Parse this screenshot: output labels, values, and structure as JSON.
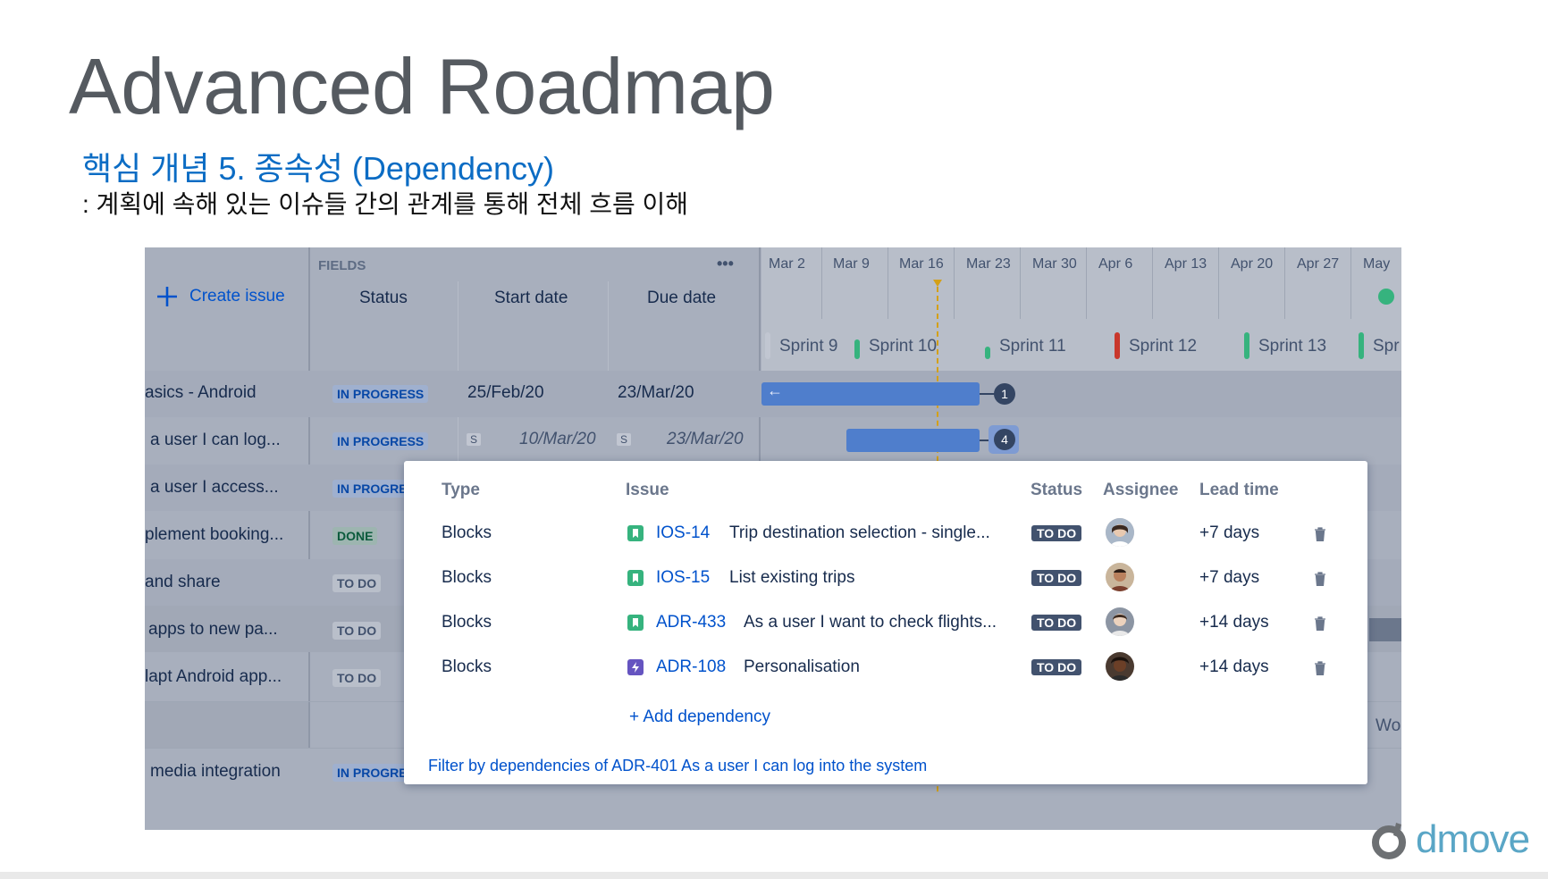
{
  "slide": {
    "title": "Advanced Roadmap",
    "subtitle": "핵심 개념 5. 종속성 (Dependency)",
    "description": ": 계획에 속해 있는 이슈들 간의 관계를 통해 전체 흐름 이해",
    "logo_text": "dmove"
  },
  "roadmap": {
    "create_issue_label": "Create issue",
    "fields_label": "FIELDS",
    "more_label": "•••",
    "columns": [
      "Status",
      "Start date",
      "Due date"
    ],
    "timeline_dates": [
      "Mar 2",
      "Mar 9",
      "Mar 16",
      "Mar 23",
      "Mar 30",
      "Apr 6",
      "Apr 13",
      "Apr 20",
      "Apr 27",
      "May"
    ],
    "sprints": [
      "Sprint 9",
      "Sprint 10",
      "Sprint 11",
      "Sprint 12",
      "Sprint 13",
      "Spr"
    ],
    "rows": [
      {
        "summary": "asics - Android",
        "status": "IN PROGRESS",
        "start": "25/Feb/20",
        "due": "23/Mar/20"
      },
      {
        "summary": "a user I can log...",
        "status": "IN PROGRESS",
        "start_tag": "S",
        "start": "10/Mar/20",
        "due_tag": "S",
        "due": "23/Mar/20"
      },
      {
        "summary": "a user I access...",
        "status": "IN PROGRE"
      },
      {
        "summary": "plement booking...",
        "status": "DONE"
      },
      {
        "summary": "and share",
        "status": "TO DO"
      },
      {
        "summary": "apps to new pa...",
        "status": "TO DO"
      },
      {
        "summary": "lapt Android app...",
        "status": "TO DO"
      },
      {
        "summary": "media integration",
        "status": "IN PROGRE"
      }
    ],
    "bar_badges": [
      "1",
      "4"
    ],
    "wo_label": "Wo",
    "arrow_label": "←"
  },
  "dependency_popup": {
    "headers": {
      "type": "Type",
      "issue": "Issue",
      "status": "Status",
      "assignee": "Assignee",
      "lead_time": "Lead time"
    },
    "items": [
      {
        "type": "Blocks",
        "key": "IOS-14",
        "summary": "Trip destination selection - single...",
        "status": "TO DO",
        "lead_time": "+7 days",
        "icon": "story-icon"
      },
      {
        "type": "Blocks",
        "key": "IOS-15",
        "summary": "List existing trips",
        "status": "TO DO",
        "lead_time": "+7 days",
        "icon": "story-icon"
      },
      {
        "type": "Blocks",
        "key": "ADR-433",
        "summary": "As a user I want to check flights...",
        "status": "TO DO",
        "lead_time": "+14 days",
        "icon": "story-icon"
      },
      {
        "type": "Blocks",
        "key": "ADR-108",
        "summary": "Personalisation",
        "status": "TO DO",
        "lead_time": "+14 days",
        "icon": "epic-icon"
      }
    ],
    "add_dependency_label": "+ Add dependency",
    "filter_link": "Filter by dependencies of ADR-401 As a user I can log into the system"
  },
  "colors": {
    "accent": "#0052cc",
    "bar": "#4f7ecc",
    "story_green": "#36b37e",
    "epic_purple": "#6554c0",
    "sprint_green": "#36b37e",
    "sprint_red": "#c9372c",
    "today_line": "#d4a017"
  }
}
